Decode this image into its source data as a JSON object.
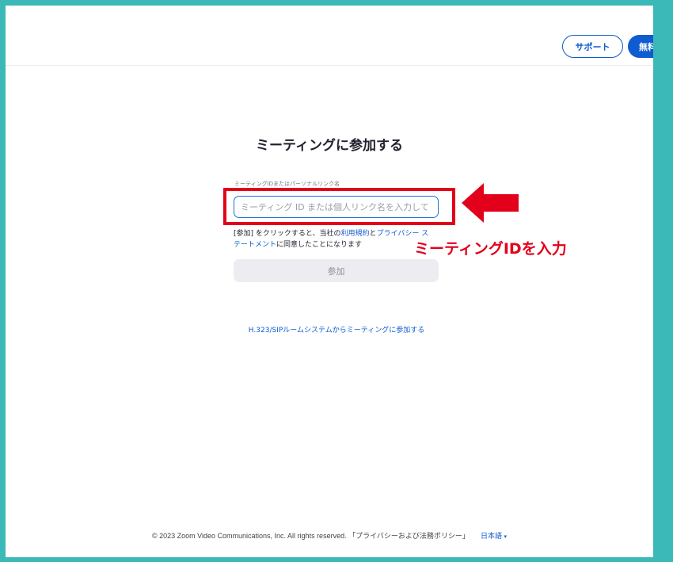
{
  "header": {
    "support_label": "サポート",
    "signup_label": "無料"
  },
  "main": {
    "title": "ミーティングに参加する",
    "field_label": "ミーティングIDまたはパーソナルリンク名",
    "input_placeholder": "ミーティング ID または個人リンク名を入力して",
    "terms": {
      "prefix": "[参加] をクリックすると、当社の",
      "terms_link": "利用規約",
      "connector": "と",
      "privacy_link": "プライバシー ステートメント",
      "suffix": "に同意したことになります"
    },
    "join_label": "参加",
    "h323_link": "H.323/SIPルームシステムからミーティングに参加する"
  },
  "annotation": {
    "text": "ミーティングIDを入力",
    "color": "#e3001b"
  },
  "footer": {
    "copyright": "© 2023 Zoom Video Communications, Inc. All rights reserved.",
    "privacy_link": "「プライバシーおよび法務ポリシー」",
    "language": "日本語",
    "language_caret": "▾"
  },
  "colors": {
    "accent": "#0e5ccf",
    "frame": "#3bb8b8",
    "highlight": "#e3001b"
  },
  "icons": {
    "annotation_arrow": "left-arrow-icon"
  }
}
